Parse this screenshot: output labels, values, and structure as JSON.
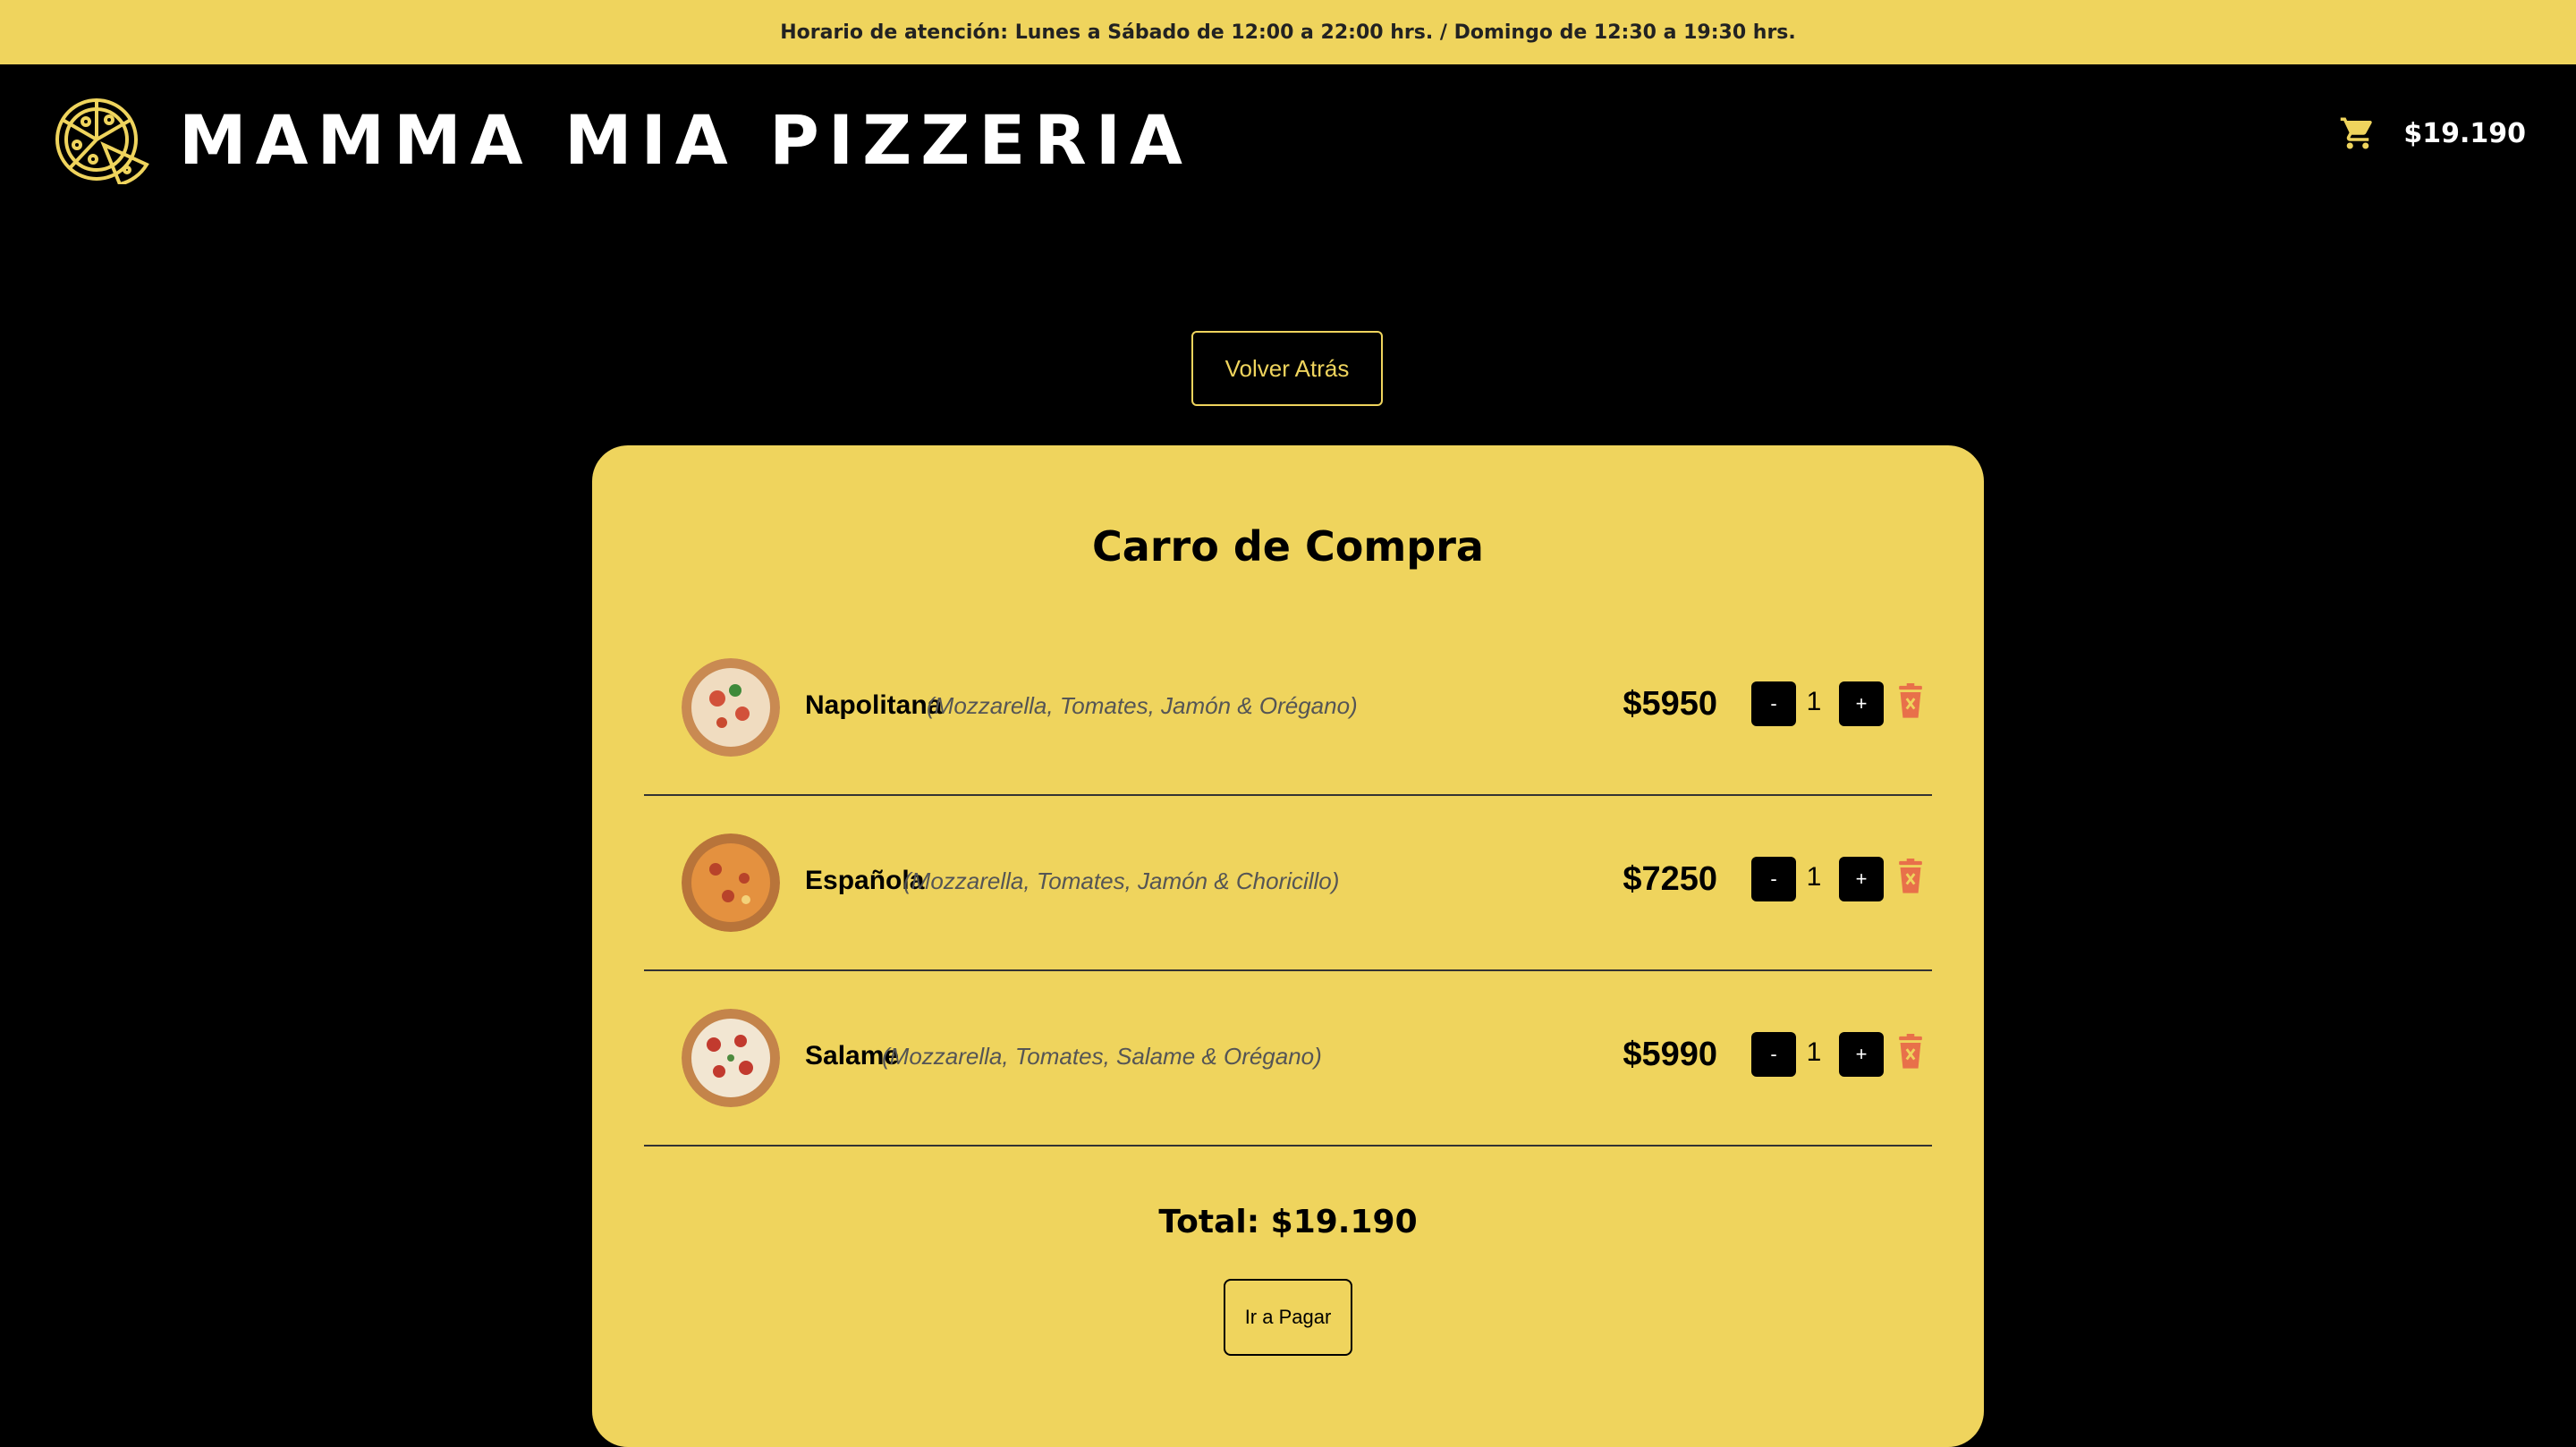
{
  "announcement": "Horario de atención: Lunes a Sábado de 12:00 a 22:00 hrs. / Domingo de 12:30 a 19:30 hrs.",
  "header": {
    "logo_icon": "pizza-icon",
    "brand": "MAMMA MIA PIZZERIA",
    "cart_icon": "cart-icon",
    "cart_total": "$19.190"
  },
  "back_button": "Volver Atrás",
  "cart": {
    "title": "Carro de Compra",
    "items": [
      {
        "name": "Napolitana",
        "description": "(Mozzarella, Tomates, Jamón & Orégano)",
        "price": "$5950",
        "qty": "1",
        "minus": "-",
        "plus": "+"
      },
      {
        "name": "Española",
        "description": "(Mozzarella, Tomates, Jamón & Choricillo)",
        "price": "$7250",
        "qty": "1",
        "minus": "-",
        "plus": "+"
      },
      {
        "name": "Salame",
        "description": "(Mozzarella, Tomates, Salame & Orégano)",
        "price": "$5990",
        "qty": "1",
        "minus": "-",
        "plus": "+"
      }
    ],
    "total": "Total: $19.190",
    "pay_button": "Ir a Pagar"
  },
  "colors": {
    "accent": "#efd45d",
    "background": "#000000",
    "delete": "#e8704a"
  }
}
